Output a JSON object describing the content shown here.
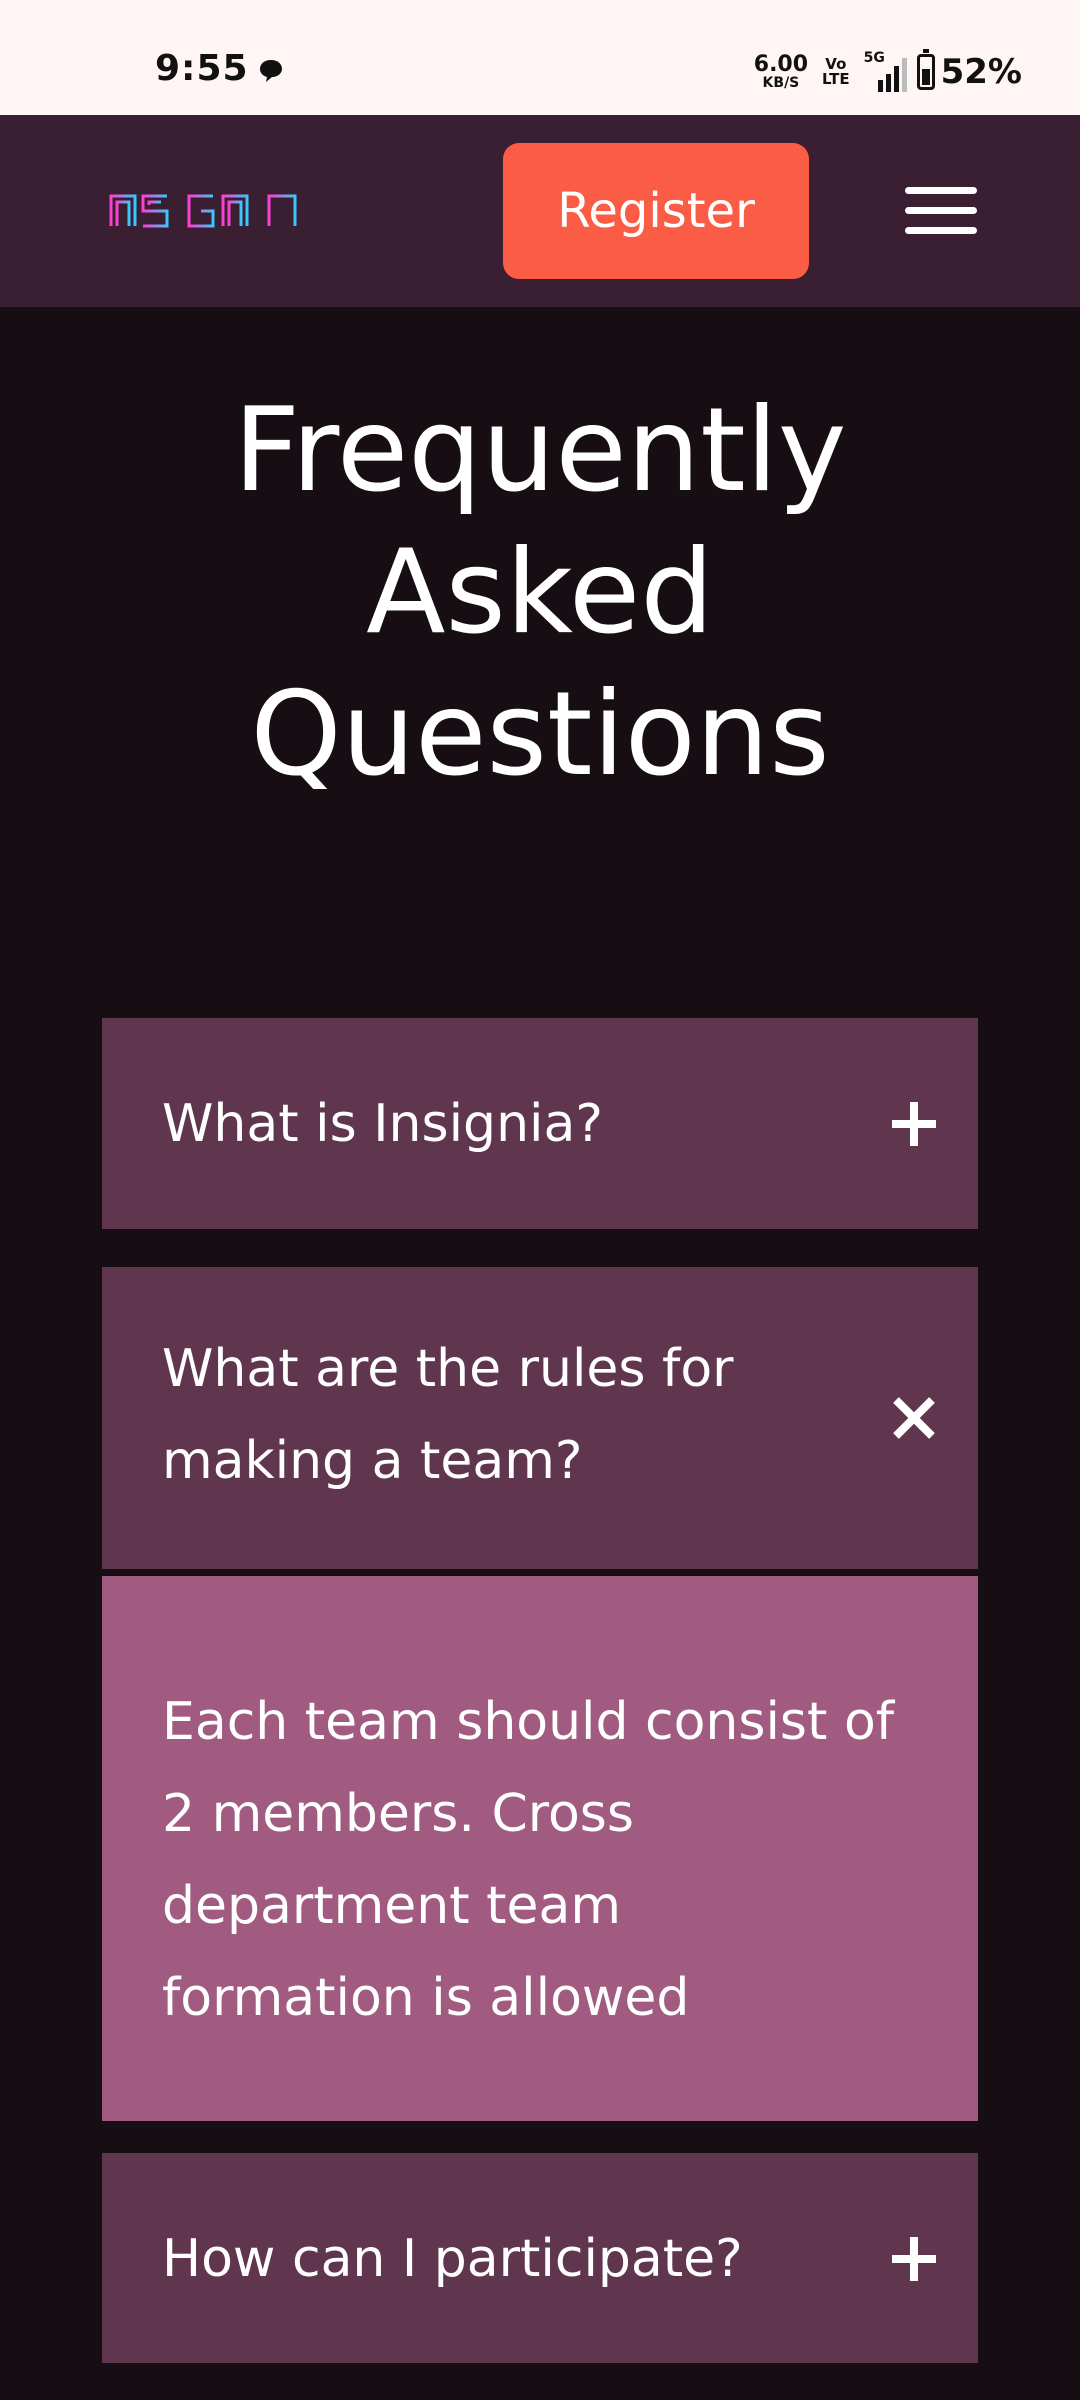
{
  "status_bar": {
    "time": "9:55",
    "net_speed": "6.00",
    "net_unit": "KB/S",
    "volte_top": "Vo",
    "volte_bottom": "LTE",
    "network": "5G",
    "battery": "52%",
    "battery_level": 0.52,
    "icons": [
      "chat-bubble-icon",
      "volte-icon",
      "signal-5g-icon",
      "battery-icon"
    ]
  },
  "header": {
    "logo_text": "INSIGNIA",
    "register_label": "Register",
    "menu_icon": "hamburger-menu-icon",
    "colors": {
      "background": "#3a1e31",
      "button": "#fa5c46"
    }
  },
  "page": {
    "title_lines": [
      "Frequently",
      "Asked",
      "Questions"
    ]
  },
  "faq": {
    "items": [
      {
        "question": "What is Insignia?",
        "icon": "plus-icon",
        "expanded": false
      },
      {
        "question_lines": [
          "What are the rules for",
          "making a team?"
        ],
        "icon": "close-icon",
        "expanded": true,
        "answer_lines": [
          "Each team should consist of",
          "2 members. Cross",
          "department team",
          "formation is allowed"
        ]
      },
      {
        "question": "How can I participate?",
        "icon": "plus-icon",
        "expanded": false
      }
    ],
    "colors": {
      "item": "#60364f",
      "answer": "#a15a80"
    }
  }
}
